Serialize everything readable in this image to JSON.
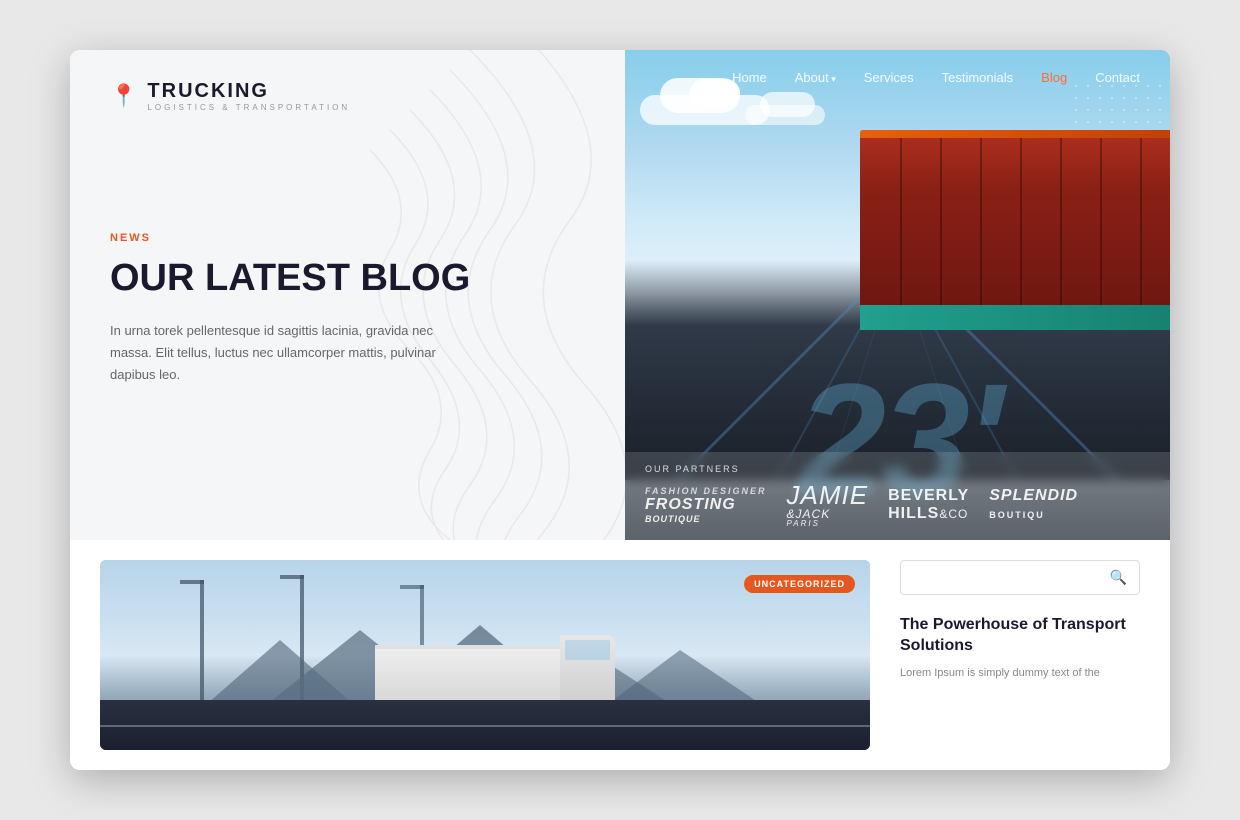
{
  "browser": {
    "shadow": true
  },
  "logo": {
    "main": "TRUCKING",
    "sub": "LOGISTICS & TRANSPORTATION",
    "icon": "📍"
  },
  "nav": {
    "items": [
      {
        "label": "Home",
        "active": false,
        "id": "home"
      },
      {
        "label": "About",
        "active": false,
        "dropdown": true,
        "id": "about"
      },
      {
        "label": "Services",
        "active": false,
        "id": "services"
      },
      {
        "label": "Testimonials",
        "active": false,
        "id": "testimonials"
      },
      {
        "label": "Blog",
        "active": true,
        "id": "blog"
      },
      {
        "label": "Contact",
        "active": false,
        "id": "contact"
      }
    ]
  },
  "hero_left": {
    "news_label": "NEWS",
    "heading": "OUR LATEST BLOG",
    "description": "In urna torek pellentesque id sagittis lacinia, gravida nec massa. Elit tellus, luctus nec ullamcorper mattis, pulvinar dapibus leo."
  },
  "hero_right": {
    "road_number": "23'",
    "partners_label": "OUR PARTNERS",
    "partners": [
      {
        "name": "FROSTING",
        "sub": "Boutique",
        "class": "frosting"
      },
      {
        "name": "Jamie & Jack",
        "class": "jj"
      },
      {
        "name": "BEVERLY HILLS&CO",
        "class": "bh"
      },
      {
        "name": "splendid BOUTIQU",
        "class": "splendid"
      }
    ]
  },
  "bottom_blog": {
    "category": "UNCATEGORIZED",
    "search_placeholder": ""
  },
  "sidebar": {
    "post_title": "The Powerhouse of Transport Solutions",
    "post_description": "Lorem Ipsum is simply dummy text of the"
  }
}
